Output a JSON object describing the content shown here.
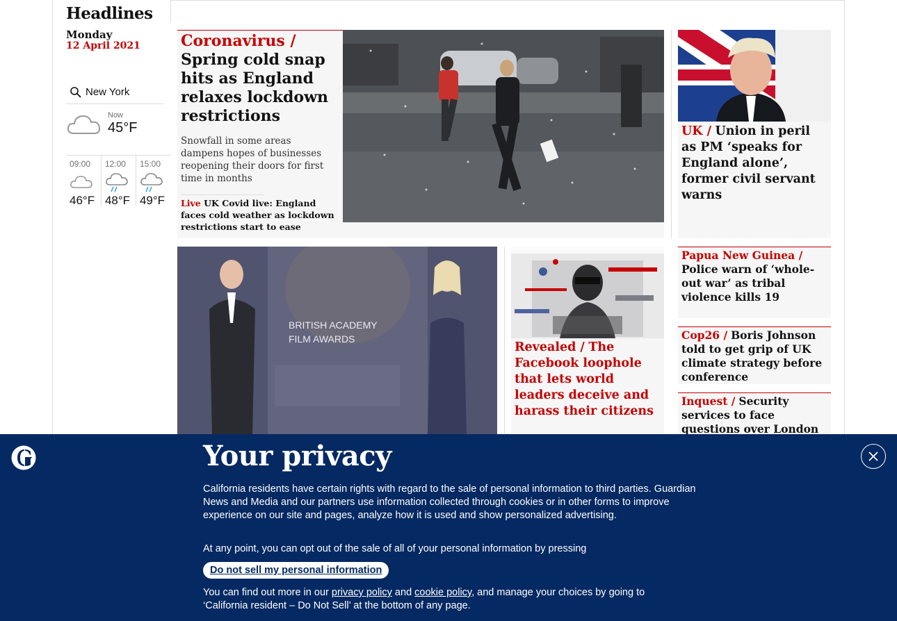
{
  "section": {
    "title": "Headlines",
    "day": "Monday",
    "date": "12 April 2021"
  },
  "weather": {
    "location": "New York",
    "now": {
      "label": "Now",
      "temp": "45°F",
      "icon": "cloud-icon"
    },
    "forecast": [
      {
        "time": "09:00",
        "temp": "46°F",
        "icon": "cloud-icon"
      },
      {
        "time": "12:00",
        "temp": "48°F",
        "icon": "rain-cloud-icon"
      },
      {
        "time": "15:00",
        "temp": "49°F",
        "icon": "rain-cloud-icon"
      }
    ]
  },
  "lead": {
    "kicker": "Coronavirus /",
    "headline": "Spring cold snap hits as England relaxes lockdown restrictions",
    "standfirst": "Snowfall in some areas dampens hopes of businesses reopening their doors for first time in months",
    "sublink_kicker": "Live",
    "sublink_text": "UK Covid live: England faces cold weather as lockdown restrictions start to ease"
  },
  "uk_story": {
    "kicker": "UK /",
    "headline": "Union in peril as PM ‘speaks for England alone’, former civil servant warns"
  },
  "facebook_story": {
    "kicker": "Revealed /",
    "headline": "The Facebook loophole that lets world leaders deceive and harass their citizens"
  },
  "side_stories": [
    {
      "kicker": "Papua New Guinea  /",
      "headline": "Police warn of ‘whole-out war’ as tribal violence kills 19"
    },
    {
      "kicker": "Cop26 /",
      "headline": "Boris Johnson told to get grip of UK climate strategy before conference"
    },
    {
      "kicker": "Inquest /",
      "headline": "Security services to face questions over London Bridge attacker"
    }
  ],
  "bafta_image": {
    "sign_line1": "BRITISH ACADEMY",
    "sign_line2": "FILM AWARDS"
  },
  "privacy": {
    "title": "Your privacy",
    "para1": "California residents have certain rights with regard to the sale of personal information to third parties. Guardian News and Media and our partners use information collected through cookies or in other forms to improve experience on our site and pages, analyze how it is used and show personalized advertising.",
    "para2": "At any point, you can opt out of the sale of all of your personal information by pressing",
    "button": "Do not sell my personal information",
    "para3_a": "You can find out more in our ",
    "link1": "privacy policy",
    "para3_b": " and ",
    "link2": "cookie policy",
    "para3_c": ", and manage your choices by going to ‘California resident – Do Not Sell’ at the bottom of any page."
  },
  "colors": {
    "news_red": "#c70000",
    "brand_blue": "#052962",
    "card_bg": "#f6f6f6"
  }
}
